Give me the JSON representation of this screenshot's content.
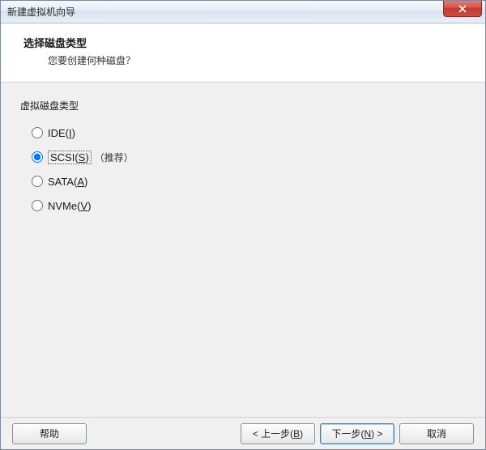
{
  "window": {
    "title": "新建虚拟机向导"
  },
  "header": {
    "title": "选择磁盘类型",
    "subtitle": "您要创建何种磁盘？"
  },
  "group": {
    "label": "虚拟磁盘类型"
  },
  "options": {
    "ide": {
      "label": "IDE(",
      "accel": "I",
      "tail": ")"
    },
    "scsi": {
      "label": "SCSI(",
      "accel": "S",
      "tail": ")",
      "suffix": "（推荐）"
    },
    "sata": {
      "label": "SATA(",
      "accel": "A",
      "tail": ")"
    },
    "nvme": {
      "label": "NVMe(",
      "accel": "V",
      "tail": ")"
    }
  },
  "buttons": {
    "help": "帮助",
    "back_pre": "< 上一步(",
    "back_accel": "B",
    "back_post": ")",
    "next_pre": "下一步(",
    "next_accel": "N",
    "next_post": ") >",
    "cancel": "取消"
  }
}
